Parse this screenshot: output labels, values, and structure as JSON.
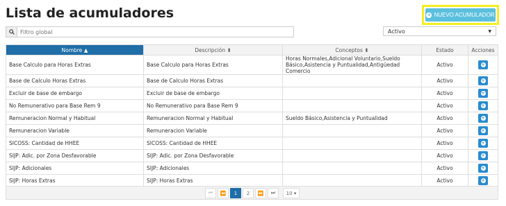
{
  "page": {
    "title": "Lista de acumuladores"
  },
  "toolbar": {
    "new_button": "NUEVO ACUMULADOR"
  },
  "filter": {
    "placeholder": "Filtro global"
  },
  "status_filter": {
    "selected": "Activo"
  },
  "table": {
    "headers": {
      "nombre": "Nombre",
      "descripcion": "Descripción",
      "conceptos": "Conceptos",
      "estado": "Estado",
      "acciones": "Acciones"
    },
    "rows": [
      {
        "nombre": "Base Calculo para Horas Extras",
        "descripcion": "Base Calculo para Horas Extras",
        "conceptos": "Horas Normales,Adicional Voluntario,Sueldo Básico,Asistencia y Puntualidad,Antigüedad Comercio",
        "estado": "Activo"
      },
      {
        "nombre": "Base de Calculo Horas Extras",
        "descripcion": "Base de Calculo Horas Extras",
        "conceptos": "",
        "estado": "Activo"
      },
      {
        "nombre": "Excluir de base de embargo",
        "descripcion": "Excluir de base de embargo",
        "conceptos": "",
        "estado": "Activo"
      },
      {
        "nombre": "No Remunerativo para Base Rem 9",
        "descripcion": "No Remunerativo para Base Rem 9",
        "conceptos": "",
        "estado": "Activo"
      },
      {
        "nombre": "Remuneracion Normal y Habitual",
        "descripcion": "Remuneracion Normal y Habitual",
        "conceptos": "Sueldo Básico,Asistencia y Puntualidad",
        "estado": "Activo"
      },
      {
        "nombre": "Remuneracion Variable",
        "descripcion": "Remuneracion Variable",
        "conceptos": "",
        "estado": "Activo"
      },
      {
        "nombre": "SICOSS: Cantidad de HHEE",
        "descripcion": "SICOSS: Cantidad de HHEE",
        "conceptos": "",
        "estado": "Activo"
      },
      {
        "nombre": "SIJP: Adic. por Zona Desfavorable",
        "descripcion": "SIJP: Adic. por Zona Desfavorable",
        "conceptos": "",
        "estado": "Activo"
      },
      {
        "nombre": "SIJP: Adicionales",
        "descripcion": "SIJP: Adicionales",
        "conceptos": "",
        "estado": "Activo"
      },
      {
        "nombre": "SIJP: Horas Extras",
        "descripcion": "SIJP: Horas Extras",
        "conceptos": "",
        "estado": "Activo"
      }
    ]
  },
  "pagination": {
    "first": "⏮",
    "prev": "⏪",
    "pages": [
      "1",
      "2"
    ],
    "next": "⏩",
    "last": "⏭",
    "page_size": "10"
  }
}
